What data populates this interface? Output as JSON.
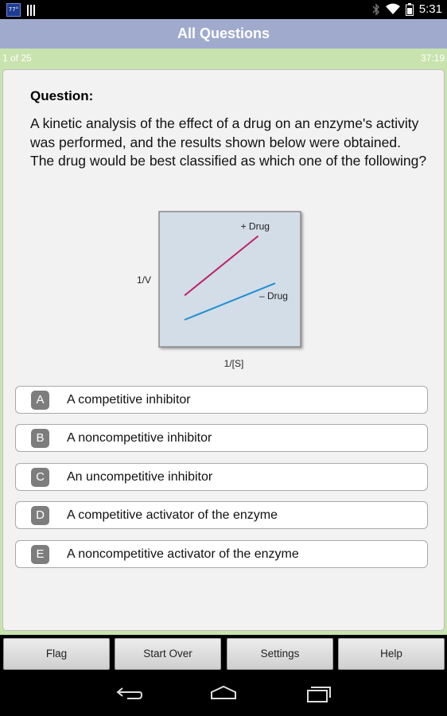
{
  "status": {
    "notification_icon": "app-icon",
    "notification_label": "77°",
    "status_icons": [
      "bluetooth-icon",
      "wifi-icon",
      "battery-icon"
    ],
    "time": "5:31"
  },
  "header": {
    "title": "All Questions"
  },
  "info": {
    "progress": "1 of 25",
    "timer": "37:19"
  },
  "question": {
    "heading": "Question:",
    "text": "A kinetic analysis of the effect of a drug on an enzyme's activity was performed, and the results shown below were obtained. The drug would be best classified as which one of the following?"
  },
  "chart_data": {
    "type": "line",
    "title": "",
    "xlabel": "1/[S]",
    "ylabel": "1/V",
    "grid": false,
    "series": [
      {
        "name": "+ Drug",
        "color": "#c0206a",
        "x": [
          0.18,
          0.7
        ],
        "y": [
          0.38,
          0.82
        ]
      },
      {
        "name": "– Drug",
        "color": "#1e8fd0",
        "x": [
          0.18,
          0.82
        ],
        "y": [
          0.2,
          0.47
        ]
      }
    ],
    "xlim": [
      0,
      1
    ],
    "ylim": [
      0,
      1
    ],
    "background": "#d2dde8"
  },
  "options": [
    {
      "letter": "A",
      "text": "A competitive inhibitor"
    },
    {
      "letter": "B",
      "text": "A noncompetitive inhibitor"
    },
    {
      "letter": "C",
      "text": "An uncompetitive inhibitor"
    },
    {
      "letter": "D",
      "text": "A competitive activator of the enzyme"
    },
    {
      "letter": "E",
      "text": "A noncompetitive activator of the enzyme"
    }
  ],
  "buttons": {
    "flag": "Flag",
    "start_over": "Start Over",
    "settings": "Settings",
    "help": "Help"
  },
  "nav_icons": [
    "back-icon",
    "home-icon",
    "recent-apps-icon"
  ]
}
